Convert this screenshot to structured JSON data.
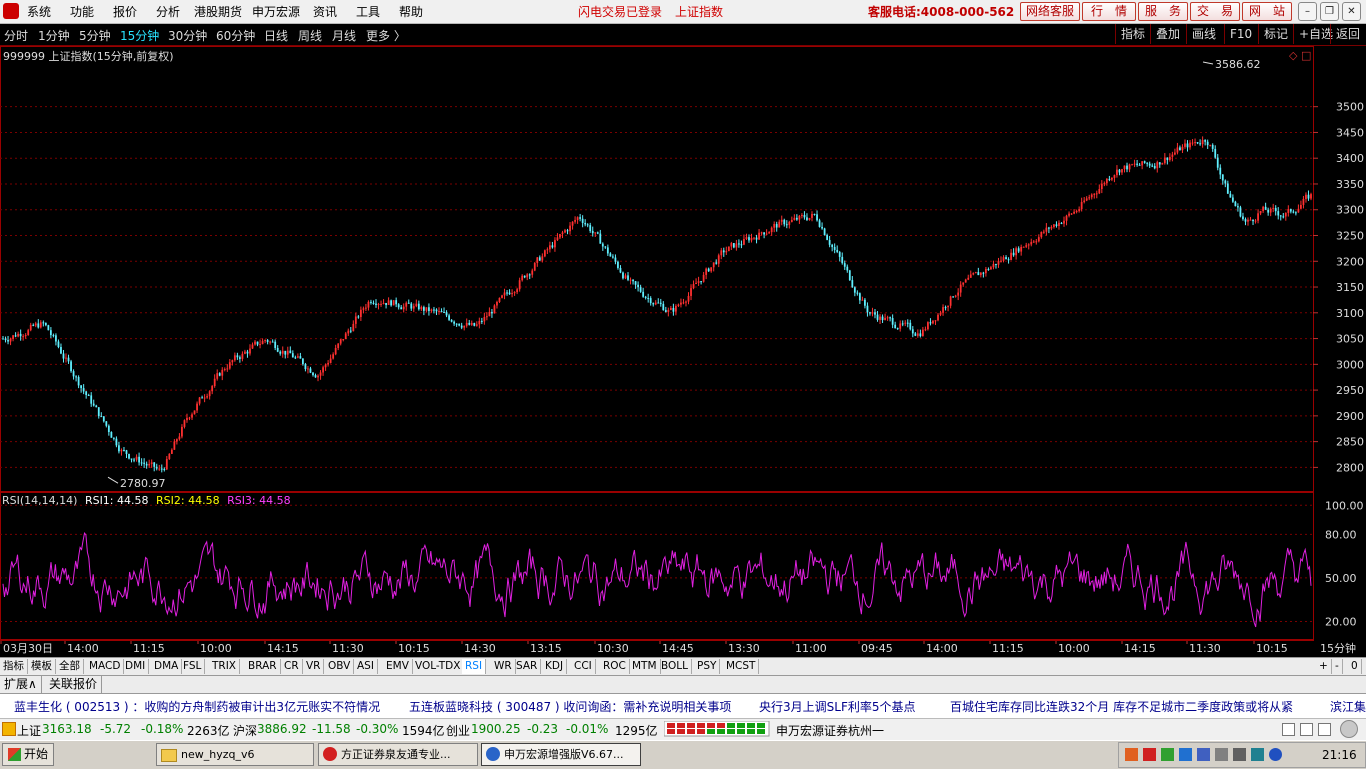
{
  "menu": {
    "items": [
      "系统",
      "功能",
      "报价",
      "分析",
      "港股期货",
      "申万宏源",
      "资讯",
      "工具",
      "帮助"
    ],
    "login_status": "闪电交易已登录",
    "index_link": "上证指数",
    "hotline": "客服电话:4008-000-562",
    "buttons": [
      "网络客服",
      "行　情",
      "服　务",
      "交　易",
      "网　站"
    ]
  },
  "periods": {
    "items": [
      "分时",
      "1分钟",
      "5分钟",
      "15分钟",
      "30分钟",
      "60分钟",
      "日线",
      "周线",
      "月线",
      "更多 〉"
    ],
    "active": "15分钟"
  },
  "toolbar": {
    "items": [
      "指标",
      "叠加",
      "画线",
      "F10",
      "标记",
      "+自选",
      "返回"
    ]
  },
  "chart_title": "999999 上证指数(15分钟,前复权)",
  "rsi_header": {
    "name": "RSI(14,14,14)",
    "rsi1": "RSI1: 44.58",
    "rsi2": "RSI2: 44.58",
    "rsi3": "RSI3: 44.58"
  },
  "time_axis": {
    "labels": [
      "03月30日",
      "14:00",
      "11:15",
      "10:00",
      "14:15",
      "11:30",
      "10:15",
      "14:30",
      "13:15",
      "10:30",
      "14:45",
      "13:30",
      "11:00",
      "09:45",
      "14:00",
      "11:15",
      "10:00",
      "14:15",
      "11:30",
      "10:15"
    ],
    "period_label": "15分钟"
  },
  "indicator_tabs": {
    "items": [
      "指标",
      "模板",
      "全部",
      "MACD",
      "DMI",
      "DMA",
      "FSL",
      "TRIX",
      "BRAR",
      "CR",
      "VR",
      "OBV",
      "ASI",
      "EMV",
      "VOL-TDX",
      "RSI",
      "WR",
      "SAR",
      "KDJ",
      "CCI",
      "ROC",
      "MTM",
      "BOLL",
      "PSY",
      "MCST"
    ],
    "active": "RSI",
    "right_controls": [
      "+",
      "-",
      "0"
    ]
  },
  "ext_tabs": [
    "扩展∧",
    "关联报价"
  ],
  "news": [
    "蓝丰生化 ( 002513 ) ：收购的方舟制药被审计出3亿元账实不符情况",
    "五连板蓝晓科技 ( 300487 ) 收问询函：需补充说明相关事项",
    "央行3月上调SLF利率5个基点",
    "百城住宅库存同比连跌32个月  库存不足城市二季度政策或将从紧",
    "滨江集"
  ],
  "status": {
    "sh_label": "上证",
    "sh_value": "3163.18",
    "sh_chg": "-5.72",
    "sh_pct": "-0.18%",
    "sh_amt": "2263亿",
    "hs_label": "沪深",
    "hs_value": "3886.92",
    "hs_chg": "-11.58",
    "hs_pct": "-0.30%",
    "hs_amt": "1594亿",
    "cy_label": "创业",
    "cy_value": "1900.25",
    "cy_chg": "-0.23",
    "cy_pct": "-0.01%",
    "cy_amt": "1295亿",
    "branch": "申万宏源证券杭州一"
  },
  "taskbar": {
    "start": "开始",
    "tasks": [
      "new_hyzq_v6",
      "方正证券泉友通专业...",
      "申万宏源增强版V6.67..."
    ],
    "clock": "21:16"
  },
  "colors": {
    "up": "#ff3030",
    "down": "#5ff0ff",
    "rsi": "#e020e0",
    "grid": "#7a0000",
    "rsi1": "#ffffff",
    "rsi2": "#ffff00",
    "rsi3": "#ff40ff"
  },
  "chart_data": [
    {
      "type": "candlestick",
      "title": "999999 上证指数(15分钟,前复权)",
      "y_ticks": [
        2800,
        2850,
        2900,
        2950,
        3000,
        3050,
        3100,
        3150,
        3200,
        3250,
        3300,
        3350,
        3400,
        3450,
        3500
      ],
      "ylim": [
        2760,
        3610
      ],
      "annotations": [
        {
          "label": "3586.62",
          "value": 3586.62,
          "kind": "high"
        },
        {
          "label": "2780.97",
          "value": 2780.97,
          "kind": "low"
        }
      ],
      "trend_x": [
        0,
        0.03,
        0.06,
        0.09,
        0.12,
        0.14,
        0.17,
        0.2,
        0.24,
        0.28,
        0.33,
        0.36,
        0.4,
        0.44,
        0.48,
        0.51,
        0.55,
        0.59,
        0.62,
        0.66,
        0.7,
        0.73,
        0.76,
        0.79,
        0.82,
        0.85,
        0.88,
        0.9,
        0.92,
        0.935,
        0.95,
        0.96,
        0.98,
        1.0
      ],
      "trend_y": [
        3050,
        3080,
        2950,
        2830,
        2790,
        2900,
        3000,
        3050,
        2980,
        3130,
        3100,
        3070,
        3180,
        3290,
        3150,
        3100,
        3220,
        3270,
        3290,
        3100,
        3060,
        3150,
        3200,
        3250,
        3300,
        3380,
        3390,
        3420,
        3440,
        3330,
        3270,
        3300,
        3290,
        3330
      ]
    },
    {
      "type": "line",
      "title": "RSI(14,14,14)",
      "series": [
        {
          "name": "RSI1",
          "last": 44.58
        }
      ],
      "y_ticks": [
        20.0,
        50.0,
        80.0,
        100.0
      ],
      "ylim": [
        10,
        105
      ]
    }
  ]
}
